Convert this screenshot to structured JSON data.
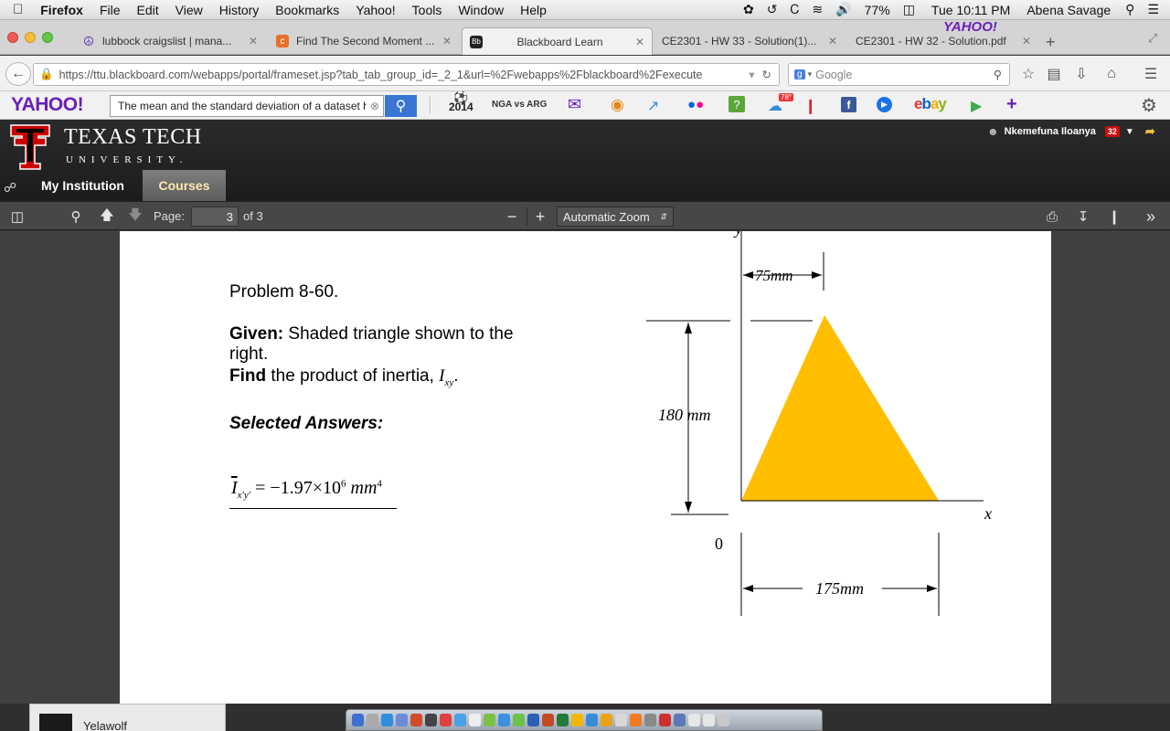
{
  "menubar": {
    "apple": "",
    "app": "Firefox",
    "items": [
      "File",
      "Edit",
      "View",
      "History",
      "Bookmarks",
      "Yahoo!",
      "Tools",
      "Window",
      "Help"
    ],
    "battery": "77%",
    "clock": "Tue 10:11 PM",
    "user": "Abena Savage"
  },
  "tabs": [
    {
      "label": "lubbock craigslist | mana...",
      "icon": "peace-icon",
      "color": "#6a3fb5"
    },
    {
      "label": "Find The Second Moment ...",
      "icon": "chegg-icon",
      "color": "#e8702a"
    },
    {
      "label": "Blackboard Learn",
      "icon": "blackboard-icon",
      "color": "#222222"
    },
    {
      "label": "CE2301 - HW 33 - Solution(1)...",
      "icon": "pdf-icon",
      "color": "#ffffff"
    },
    {
      "label": "CE2301 - HW 32 - Solution.pdf",
      "icon": "pdf-icon",
      "color": "#ffffff"
    }
  ],
  "tabbar": {
    "yahoo_logo": "YAHOO!"
  },
  "navbar": {
    "url": "https://ttu.blackboard.com/webapps/portal/frameset.jsp?tab_tab_group_id=_2_1&url=%2Fwebapps%2Fblackboard%2Fexecute",
    "search_engine": "Google"
  },
  "yahoo_toolbar": {
    "logo": "YAHOO!",
    "search_value": "The mean and the standard deviation of a dataset h",
    "worldcup": "2014",
    "match": "NGA vs ARG",
    "weather": "78°",
    "ebay": "ebay"
  },
  "bb": {
    "name": "TEXAS TECH",
    "university": "UNIVERSITY.",
    "nav": [
      "My Institution",
      "Courses"
    ],
    "user": "Nkemefuna Iloanya",
    "notifications": "32"
  },
  "pdf_toolbar": {
    "page_label": "Page:",
    "page_value": "3",
    "page_total": "of 3",
    "zoom": "Automatic Zoom"
  },
  "doc": {
    "problem": "Problem 8-60.",
    "given_label": "Given:",
    "given_text": " Shaded triangle shown to the",
    "given_text2": "right.",
    "find_label": "Find",
    "find_text": " the product of inertia, ",
    "find_symbol": "I",
    "find_sub": "xy",
    "find_end": ".",
    "selected": "Selected Answers:",
    "answer_symbol": "I",
    "answer_sub": "x'y'",
    "answer_eq": " = −1.97×10",
    "answer_exp": "6",
    "answer_unit": " mm",
    "answer_unit_exp": "4"
  },
  "figure": {
    "dim_top": "75mm",
    "dim_height": "180 mm",
    "dim_base": "175mm",
    "axis_x": "x",
    "axis_y": "y",
    "origin": "0",
    "fill": "#FFBE00"
  },
  "dock": {
    "chat_name": "Yelawolf"
  }
}
